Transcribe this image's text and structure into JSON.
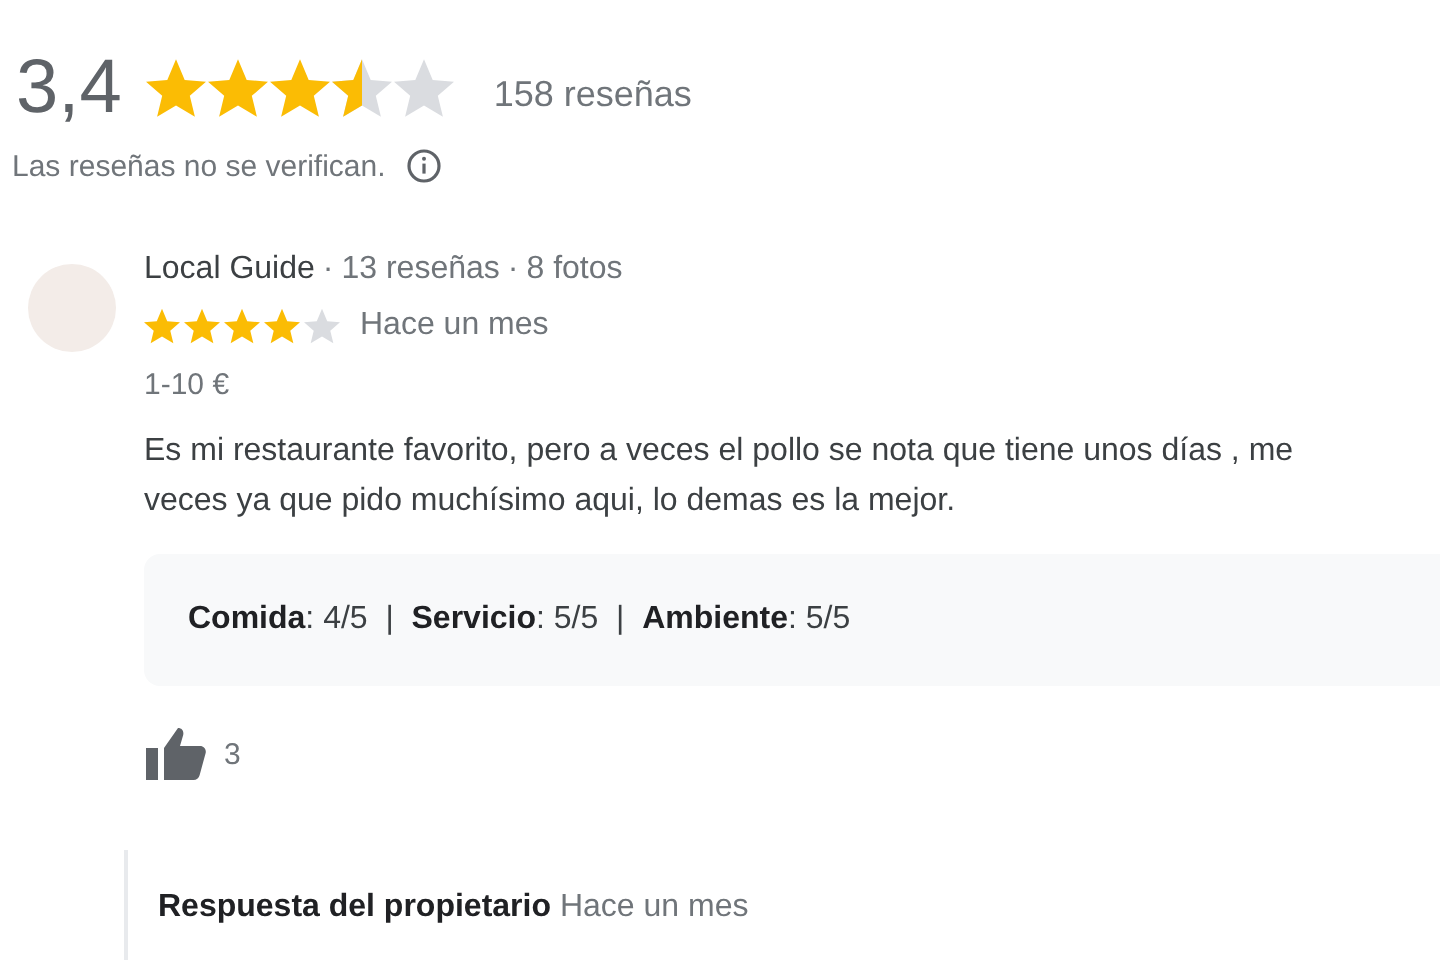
{
  "summary": {
    "rating": "3,4",
    "stars": 3.5,
    "count": "158 reseñas",
    "note": "Las reseñas no se verifican."
  },
  "review": {
    "author_line": "Local Guide",
    "separator": "·",
    "reviews": "13 reseñas",
    "photos": "8 fotos",
    "stars": 4,
    "date": "Hace un mes",
    "price": "1-10 €",
    "text_lines": [
      "Es mi restaurante favorito, pero a veces el pollo se nota que tiene unos días , me",
      "veces ya que pido muchísimo aqui, lo demas es la mejor."
    ],
    "aspects": "**Comida**: 4/5  |  **Servicio**: 5/5  |  **Ambiente**: 5/5",
    "likes": "3",
    "reply": {
      "title": "Respuesta del propietario",
      "date": "Hace un mes"
    }
  }
}
